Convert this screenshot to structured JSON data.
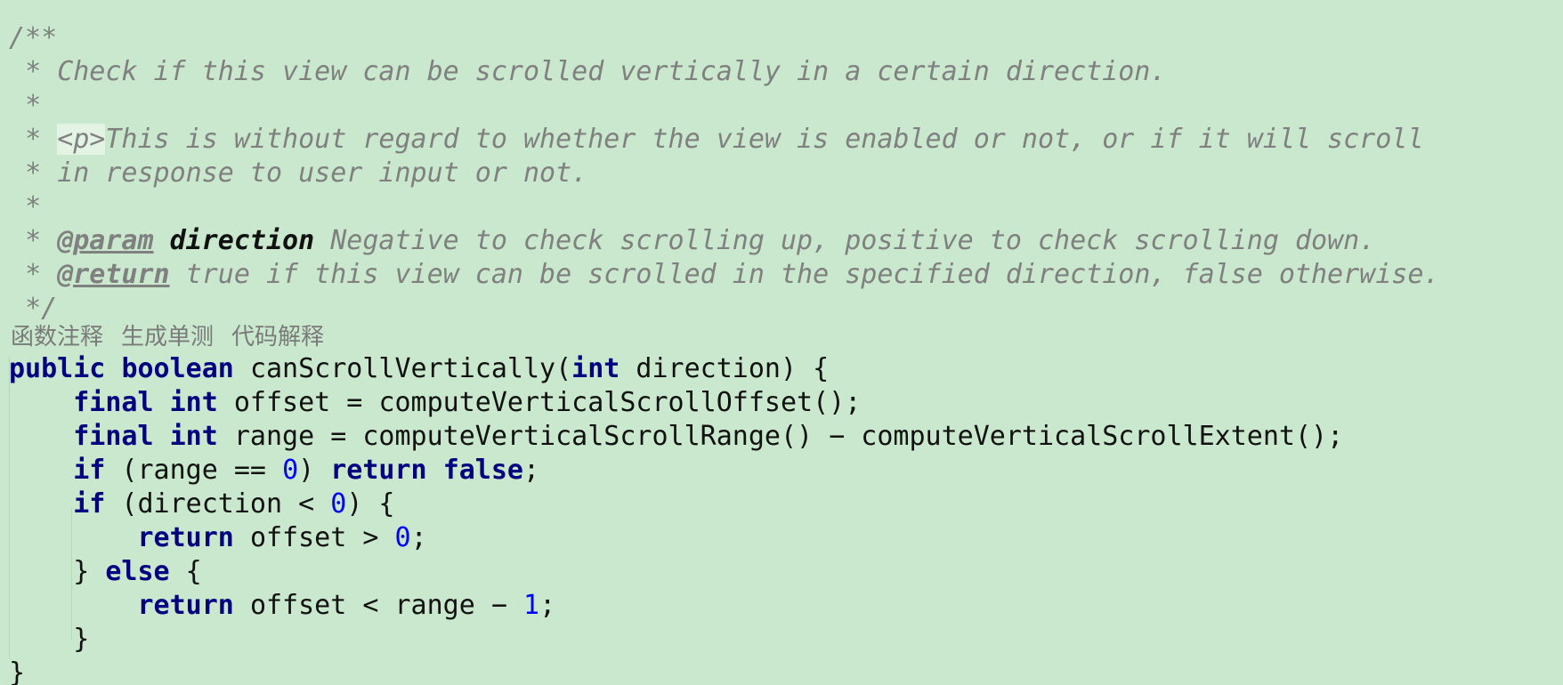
{
  "doc_comment": {
    "open": "/**",
    "star": "*",
    "close": "*/",
    "summary": "Check if this view can be scrolled vertically in a certain direction.",
    "p_tag": "<p>",
    "para_line1": "This is without regard to whether the view is enabled or not, or if it will scroll",
    "para_line2": "in response to user input or not.",
    "param_tag": "@param",
    "param_name": "direction",
    "param_desc": "Negative to check scrolling up, positive to check scrolling down.",
    "return_tag": "@return",
    "return_desc": "true if this view can be scrolled in the specified direction, false otherwise."
  },
  "code_hints": [
    "函数注释",
    "生成单测",
    "代码解释"
  ],
  "code": {
    "kw_public": "public",
    "kw_boolean": "boolean",
    "method_name": "canScrollVertically",
    "kw_int": "int",
    "param": "direction",
    "kw_final": "final",
    "var_offset": "offset",
    "call_offset": "computeVerticalScrollOffset",
    "var_range": "range",
    "call_range": "computeVerticalScrollRange",
    "call_extent": "computeVerticalScrollExtent",
    "kw_if": "if",
    "kw_return": "return",
    "kw_false": "false",
    "kw_else": "else",
    "num_zero": "0",
    "num_one": "1"
  }
}
